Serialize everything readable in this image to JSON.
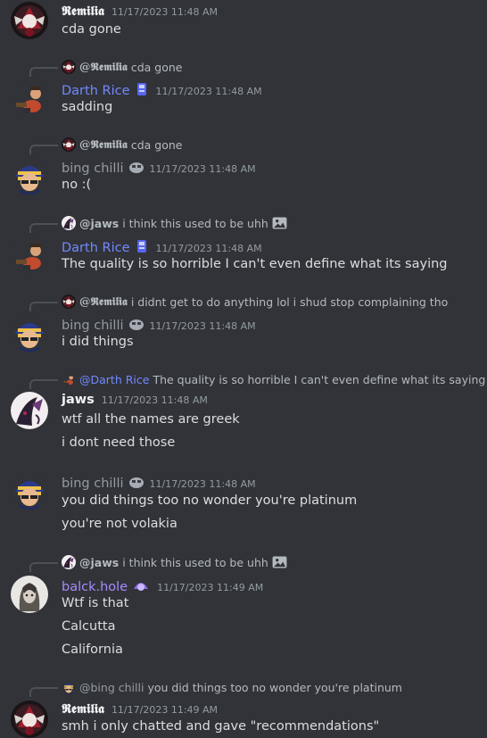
{
  "colors": {
    "background": "#313338",
    "remilia": "#f2f3f5",
    "darth": "#7289ff",
    "bing": "#949ba4",
    "jaws": "#f2f3f5",
    "balck": "#a78bfa"
  },
  "messages": [
    {
      "author": "𝕽𝖊𝖒𝖎𝖑𝖎𝖆",
      "timestamp": "11/17/2023 11:48 AM",
      "lines": [
        "cda gone"
      ]
    },
    {
      "reply": {
        "author": "@𝕽𝖊𝖒𝖎𝖑𝖎𝖆",
        "text": "cda gone"
      },
      "author": "Darth Rice",
      "timestamp": "11/17/2023 11:48 AM",
      "lines": [
        "sadding"
      ]
    },
    {
      "reply": {
        "author": "@𝕽𝖊𝖒𝖎𝖑𝖎𝖆",
        "text": "cda gone"
      },
      "author": "bing chilli",
      "timestamp": "11/17/2023 11:48 AM",
      "lines": [
        "no :("
      ]
    },
    {
      "reply": {
        "author": "@jaws",
        "text": "i think this used to be uhh"
      },
      "author": "Darth Rice",
      "timestamp": "11/17/2023 11:48 AM",
      "lines": [
        "The quality is so horrible I can't even define what its saying"
      ]
    },
    {
      "reply": {
        "author": "@𝕽𝖊𝖒𝖎𝖑𝖎𝖆",
        "text": "i didnt get to do anything lol i shud stop complaining tho"
      },
      "author": "bing chilli",
      "timestamp": "11/17/2023 11:48 AM",
      "lines": [
        "i did things"
      ]
    },
    {
      "reply": {
        "author": "@Darth Rice",
        "text": "The quality is so horrible I can't even define what its saying"
      },
      "author": "jaws",
      "timestamp": "11/17/2023 11:48 AM",
      "lines": [
        "wtf all the names are greek",
        "i dont need those"
      ]
    },
    {
      "author": "bing chilli",
      "timestamp": "11/17/2023 11:48 AM",
      "lines": [
        "you did things too no wonder you're platinum",
        "you're not volakia"
      ]
    },
    {
      "reply": {
        "author": "@jaws",
        "text": "i think this used to be uhh"
      },
      "author": "balck.hole",
      "timestamp": "11/17/2023 11:49 AM",
      "lines": [
        "Wtf is that",
        "Calcutta",
        "California"
      ]
    },
    {
      "reply": {
        "author": "@bing chilli",
        "text": "you did things too no wonder you're platinum"
      },
      "author": "𝕽𝖊𝖒𝖎𝖑𝖎𝖆",
      "timestamp": "11/17/2023 11:49 AM",
      "lines": [
        "smh i only chatted and gave \"recommendations\""
      ]
    }
  ]
}
